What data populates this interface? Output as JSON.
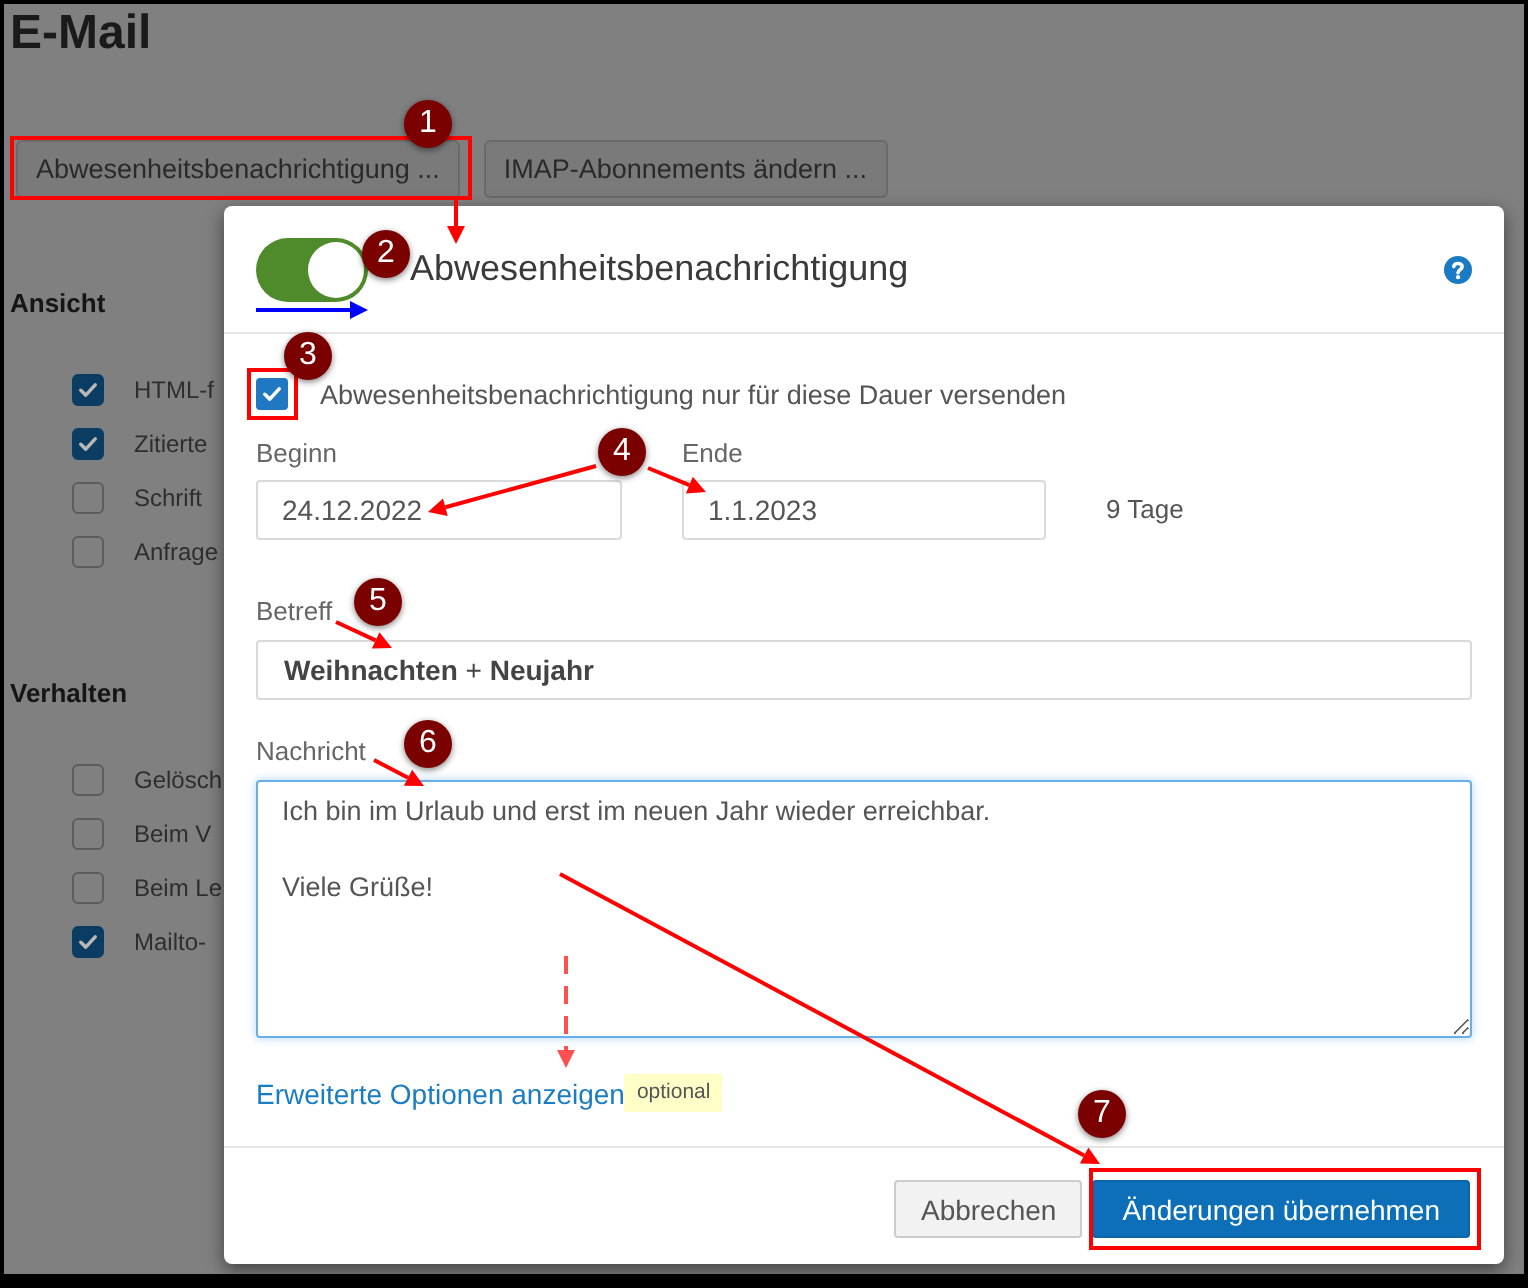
{
  "page": {
    "title": "E-Mail",
    "buttons": [
      {
        "label": "Abwesenheitsbenachrichtigung ..."
      },
      {
        "label": "IMAP-Abonnements ändern ..."
      }
    ],
    "sections": [
      {
        "heading": "Ansicht",
        "options": [
          {
            "label": "HTML-f",
            "checked": true
          },
          {
            "label": "Zitierte",
            "checked": true
          },
          {
            "label": "Schrift",
            "checked": false
          },
          {
            "label": "Anfrage",
            "checked": false
          }
        ]
      },
      {
        "heading": "Verhalten",
        "options": [
          {
            "label": "Gelösch",
            "checked": false
          },
          {
            "label": "Beim V",
            "checked": false
          },
          {
            "label": "Beim Le",
            "checked": false
          },
          {
            "label": "Mailto-",
            "checked": true
          }
        ]
      }
    ]
  },
  "dialog": {
    "enabled": true,
    "title": "Abwesenheitsbenachrichtigung",
    "limit_period": {
      "label": "Abwesenheitsbenachrichtigung nur für diese Dauer versenden",
      "checked": true
    },
    "start": {
      "label": "Beginn",
      "value": "24.12.2022"
    },
    "end": {
      "label": "Ende",
      "value": "1.1.2023"
    },
    "duration": "9 Tage",
    "subject": {
      "label": "Betreff",
      "value": "**Weihnachten** + **Neujahr**"
    },
    "message": {
      "label": "Nachricht",
      "value": "Ich bin im Urlaub und erst im neuen Jahr wieder erreichbar.\n\nViele Grüße!"
    },
    "advanced_link": {
      "label": "Erweiterte Optionen anzeigen",
      "badge": "optional"
    },
    "buttons": [
      {
        "label": "Abbrechen",
        "kind": "secondary"
      },
      {
        "label": "Änderungen übernehmen",
        "kind": "primary"
      }
    ]
  },
  "step_markers": [
    {
      "label": "1"
    },
    {
      "label": "2"
    },
    {
      "label": "3"
    },
    {
      "label": "4"
    },
    {
      "label": "5"
    },
    {
      "label": "6"
    },
    {
      "label": "7"
    }
  ]
}
